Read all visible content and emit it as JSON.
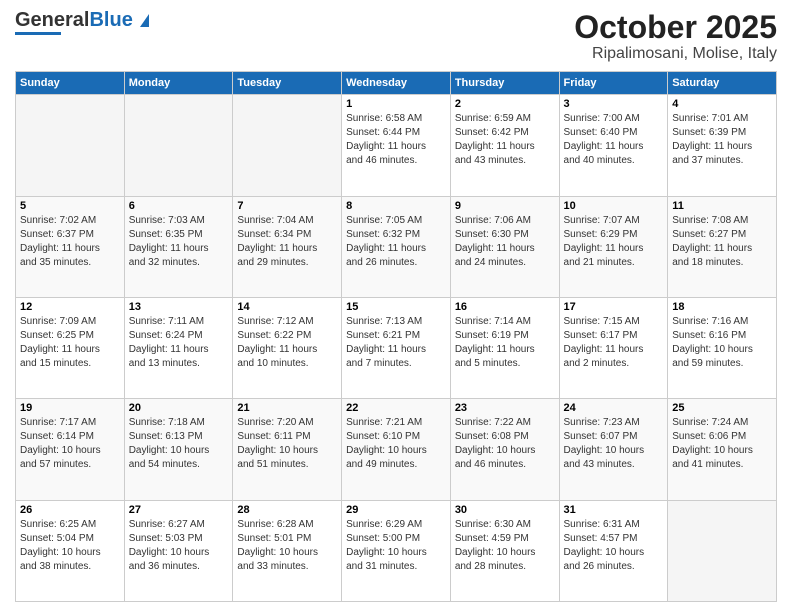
{
  "header": {
    "logo_general": "General",
    "logo_blue": "Blue",
    "title": "October 2025",
    "subtitle": "Ripalimosani, Molise, Italy"
  },
  "days_of_week": [
    "Sunday",
    "Monday",
    "Tuesday",
    "Wednesday",
    "Thursday",
    "Friday",
    "Saturday"
  ],
  "weeks": [
    [
      {
        "day": "",
        "info": ""
      },
      {
        "day": "",
        "info": ""
      },
      {
        "day": "",
        "info": ""
      },
      {
        "day": "1",
        "info": "Sunrise: 6:58 AM\nSunset: 6:44 PM\nDaylight: 11 hours\nand 46 minutes."
      },
      {
        "day": "2",
        "info": "Sunrise: 6:59 AM\nSunset: 6:42 PM\nDaylight: 11 hours\nand 43 minutes."
      },
      {
        "day": "3",
        "info": "Sunrise: 7:00 AM\nSunset: 6:40 PM\nDaylight: 11 hours\nand 40 minutes."
      },
      {
        "day": "4",
        "info": "Sunrise: 7:01 AM\nSunset: 6:39 PM\nDaylight: 11 hours\nand 37 minutes."
      }
    ],
    [
      {
        "day": "5",
        "info": "Sunrise: 7:02 AM\nSunset: 6:37 PM\nDaylight: 11 hours\nand 35 minutes."
      },
      {
        "day": "6",
        "info": "Sunrise: 7:03 AM\nSunset: 6:35 PM\nDaylight: 11 hours\nand 32 minutes."
      },
      {
        "day": "7",
        "info": "Sunrise: 7:04 AM\nSunset: 6:34 PM\nDaylight: 11 hours\nand 29 minutes."
      },
      {
        "day": "8",
        "info": "Sunrise: 7:05 AM\nSunset: 6:32 PM\nDaylight: 11 hours\nand 26 minutes."
      },
      {
        "day": "9",
        "info": "Sunrise: 7:06 AM\nSunset: 6:30 PM\nDaylight: 11 hours\nand 24 minutes."
      },
      {
        "day": "10",
        "info": "Sunrise: 7:07 AM\nSunset: 6:29 PM\nDaylight: 11 hours\nand 21 minutes."
      },
      {
        "day": "11",
        "info": "Sunrise: 7:08 AM\nSunset: 6:27 PM\nDaylight: 11 hours\nand 18 minutes."
      }
    ],
    [
      {
        "day": "12",
        "info": "Sunrise: 7:09 AM\nSunset: 6:25 PM\nDaylight: 11 hours\nand 15 minutes."
      },
      {
        "day": "13",
        "info": "Sunrise: 7:11 AM\nSunset: 6:24 PM\nDaylight: 11 hours\nand 13 minutes."
      },
      {
        "day": "14",
        "info": "Sunrise: 7:12 AM\nSunset: 6:22 PM\nDaylight: 11 hours\nand 10 minutes."
      },
      {
        "day": "15",
        "info": "Sunrise: 7:13 AM\nSunset: 6:21 PM\nDaylight: 11 hours\nand 7 minutes."
      },
      {
        "day": "16",
        "info": "Sunrise: 7:14 AM\nSunset: 6:19 PM\nDaylight: 11 hours\nand 5 minutes."
      },
      {
        "day": "17",
        "info": "Sunrise: 7:15 AM\nSunset: 6:17 PM\nDaylight: 11 hours\nand 2 minutes."
      },
      {
        "day": "18",
        "info": "Sunrise: 7:16 AM\nSunset: 6:16 PM\nDaylight: 10 hours\nand 59 minutes."
      }
    ],
    [
      {
        "day": "19",
        "info": "Sunrise: 7:17 AM\nSunset: 6:14 PM\nDaylight: 10 hours\nand 57 minutes."
      },
      {
        "day": "20",
        "info": "Sunrise: 7:18 AM\nSunset: 6:13 PM\nDaylight: 10 hours\nand 54 minutes."
      },
      {
        "day": "21",
        "info": "Sunrise: 7:20 AM\nSunset: 6:11 PM\nDaylight: 10 hours\nand 51 minutes."
      },
      {
        "day": "22",
        "info": "Sunrise: 7:21 AM\nSunset: 6:10 PM\nDaylight: 10 hours\nand 49 minutes."
      },
      {
        "day": "23",
        "info": "Sunrise: 7:22 AM\nSunset: 6:08 PM\nDaylight: 10 hours\nand 46 minutes."
      },
      {
        "day": "24",
        "info": "Sunrise: 7:23 AM\nSunset: 6:07 PM\nDaylight: 10 hours\nand 43 minutes."
      },
      {
        "day": "25",
        "info": "Sunrise: 7:24 AM\nSunset: 6:06 PM\nDaylight: 10 hours\nand 41 minutes."
      }
    ],
    [
      {
        "day": "26",
        "info": "Sunrise: 6:25 AM\nSunset: 5:04 PM\nDaylight: 10 hours\nand 38 minutes."
      },
      {
        "day": "27",
        "info": "Sunrise: 6:27 AM\nSunset: 5:03 PM\nDaylight: 10 hours\nand 36 minutes."
      },
      {
        "day": "28",
        "info": "Sunrise: 6:28 AM\nSunset: 5:01 PM\nDaylight: 10 hours\nand 33 minutes."
      },
      {
        "day": "29",
        "info": "Sunrise: 6:29 AM\nSunset: 5:00 PM\nDaylight: 10 hours\nand 31 minutes."
      },
      {
        "day": "30",
        "info": "Sunrise: 6:30 AM\nSunset: 4:59 PM\nDaylight: 10 hours\nand 28 minutes."
      },
      {
        "day": "31",
        "info": "Sunrise: 6:31 AM\nSunset: 4:57 PM\nDaylight: 10 hours\nand 26 minutes."
      },
      {
        "day": "",
        "info": ""
      }
    ]
  ]
}
